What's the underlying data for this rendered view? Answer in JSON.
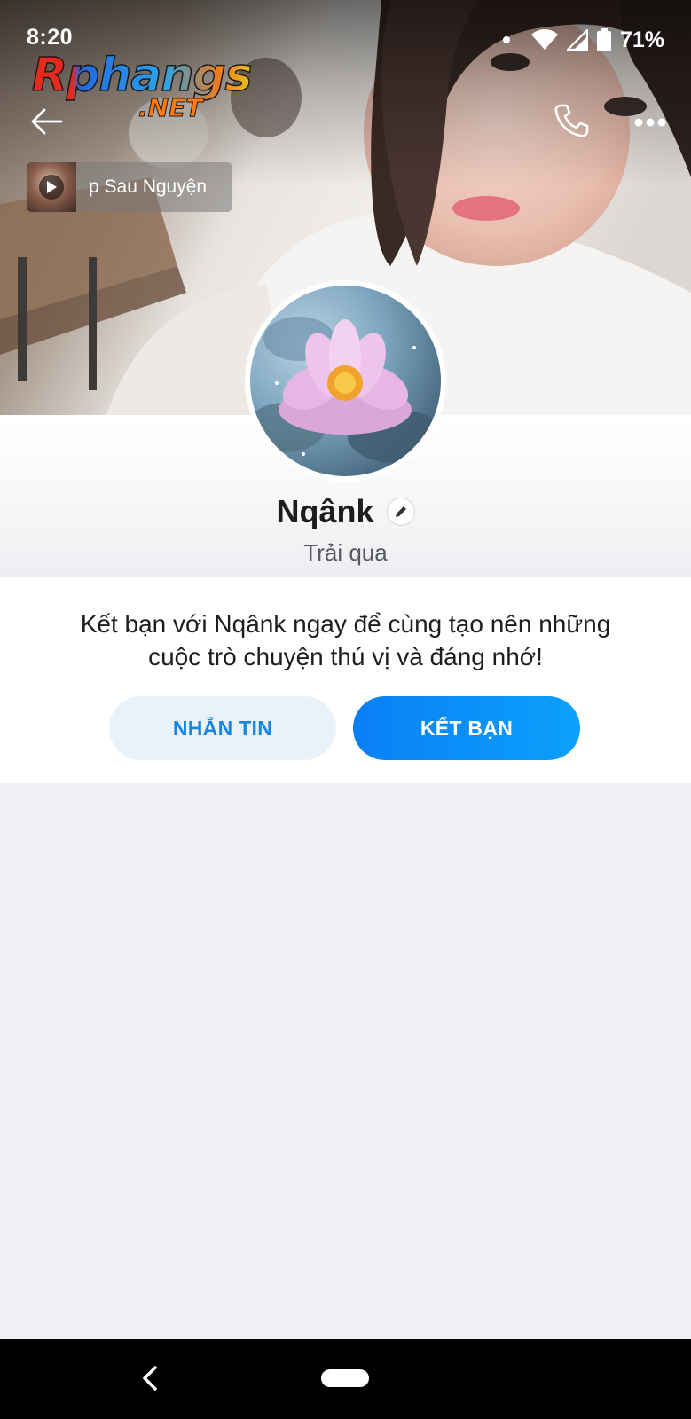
{
  "status_bar": {
    "time": "8:20",
    "battery": "71%"
  },
  "watermark": {
    "main": "Rphangs",
    "sub": ".NET"
  },
  "header": {
    "back_icon": "arrow-left-icon",
    "call_icon": "phone-icon",
    "more_icon": "more-horizontal-icon"
  },
  "music": {
    "title": "p Sau Nguyện",
    "play_icon": "play-icon"
  },
  "profile": {
    "name": "Nqânk",
    "subtitle": "Trải qua",
    "edit_icon": "pencil-icon"
  },
  "invite": {
    "text": "Kết bạn với Nqânk ngay để cùng tạo nên những cuộc trò chuyện thú vị và đáng nhớ!",
    "message_button": "NHẮN TIN",
    "add_friend_button": "KẾT BẠN"
  },
  "colors": {
    "accent": "#0a8ef7",
    "message_button_bg": "#eaf2f9",
    "page_bg": "#eff0f4"
  }
}
